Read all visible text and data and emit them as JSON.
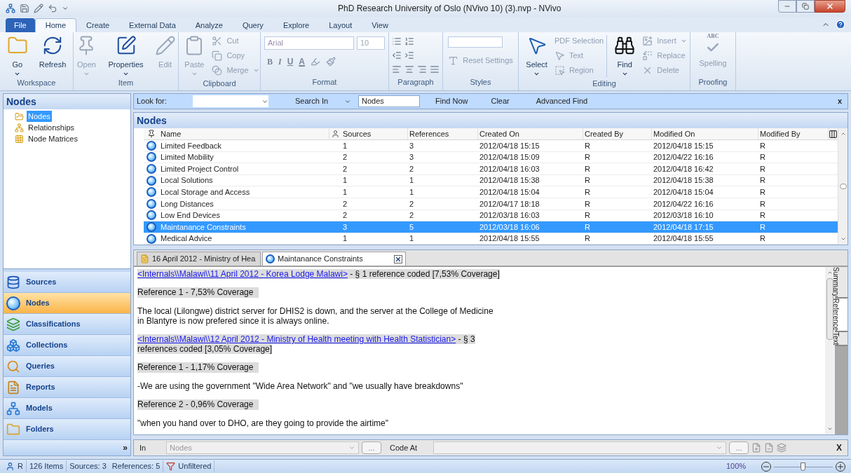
{
  "window": {
    "title": "PhD Research University of Oslo (NVivo 10) (3).nvp - NVivo"
  },
  "ribbon_tabs": [
    {
      "label": "File",
      "kind": "file",
      "selected": false
    },
    {
      "label": "Home",
      "kind": "tab",
      "selected": true
    },
    {
      "label": "Create",
      "kind": "tab",
      "selected": false
    },
    {
      "label": "External Data",
      "kind": "tab",
      "selected": false
    },
    {
      "label": "Analyze",
      "kind": "tab",
      "selected": false
    },
    {
      "label": "Query",
      "kind": "tab",
      "selected": false
    },
    {
      "label": "Explore",
      "kind": "tab",
      "selected": false
    },
    {
      "label": "Layout",
      "kind": "tab",
      "selected": false
    },
    {
      "label": "View",
      "kind": "tab",
      "selected": false
    }
  ],
  "ribbon": {
    "workspace": {
      "label": "Workspace",
      "go": {
        "label": "Go",
        "disabled": false
      },
      "refresh": {
        "label": "Refresh",
        "disabled": false
      }
    },
    "item": {
      "label": "Item",
      "open": {
        "label": "Open",
        "disabled": true
      },
      "properties": {
        "label": "Properties",
        "disabled": false
      },
      "edit": {
        "label": "Edit",
        "disabled": true
      }
    },
    "clipboard": {
      "label": "Clipboard",
      "paste": {
        "label": "Paste",
        "disabled": true
      },
      "cut": {
        "label": "Cut",
        "disabled": true
      },
      "copy": {
        "label": "Copy",
        "disabled": true
      },
      "merge": {
        "label": "Merge",
        "disabled": true
      }
    },
    "format": {
      "label": "Format",
      "font": {
        "value": "Arial",
        "disabled": true
      },
      "size": {
        "value": "10",
        "disabled": true
      },
      "bold": "B",
      "italic": "I",
      "underline": "U",
      "font_color": "A"
    },
    "paragraph": {
      "label": "Paragraph"
    },
    "styles": {
      "label": "Styles",
      "reset": {
        "label": "Reset Settings",
        "disabled": true
      }
    },
    "editing": {
      "label": "Editing",
      "select": {
        "label": "Select",
        "disabled": false
      },
      "pdf_selection": {
        "label": "PDF Selection",
        "disabled": true
      },
      "text": {
        "label": "Text",
        "disabled": true
      },
      "region": {
        "label": "Region",
        "disabled": true
      },
      "find": {
        "label": "Find",
        "disabled": false
      },
      "insert": {
        "label": "Insert",
        "disabled": true
      },
      "replace": {
        "label": "Replace",
        "disabled": true
      },
      "delete": {
        "label": "Delete",
        "disabled": true
      }
    },
    "proofing": {
      "label": "Proofing",
      "spelling": {
        "label": "Spelling",
        "badge": "ABC",
        "disabled": true
      }
    }
  },
  "navigation": {
    "title": "Nodes",
    "tree": [
      {
        "label": "Nodes",
        "selected": true
      },
      {
        "label": "Relationships",
        "selected": false
      },
      {
        "label": "Node Matrices",
        "selected": false
      }
    ],
    "buttons": [
      {
        "label": "Sources",
        "selected": false
      },
      {
        "label": "Nodes",
        "selected": true
      },
      {
        "label": "Classifications",
        "selected": false
      },
      {
        "label": "Collections",
        "selected": false
      },
      {
        "label": "Queries",
        "selected": false
      },
      {
        "label": "Reports",
        "selected": false
      },
      {
        "label": "Models",
        "selected": false
      },
      {
        "label": "Folders",
        "selected": false
      }
    ],
    "more": "»"
  },
  "find_bar": {
    "look_for_label": "Look for:",
    "search_in_label": "Search In",
    "search_in_value": "Nodes",
    "find_now": "Find Now",
    "clear": "Clear",
    "advanced_find": "Advanced Find",
    "close": "x"
  },
  "list": {
    "title": "Nodes",
    "columns": [
      "Name",
      "Sources",
      "References",
      "Created On",
      "Created By",
      "Modified On",
      "Modified By"
    ],
    "rows": [
      {
        "cells": [
          "Limited Feedback",
          "1",
          "3",
          "2012/04/18 15:15",
          "R",
          "2012/04/18 15:15",
          "R"
        ],
        "selected": false
      },
      {
        "cells": [
          "Limited Mobility",
          "2",
          "3",
          "2012/04/18 15:09",
          "R",
          "2012/04/22 16:16",
          "R"
        ],
        "selected": false
      },
      {
        "cells": [
          "Limited Project Control",
          "2",
          "2",
          "2012/04/18 16:03",
          "R",
          "2012/04/18 16:42",
          "R"
        ],
        "selected": false
      },
      {
        "cells": [
          "Local Solutions",
          "1",
          "1",
          "2012/04/18 15:38",
          "R",
          "2012/04/18 15:38",
          "R"
        ],
        "selected": false
      },
      {
        "cells": [
          "Local Storage and Access",
          "1",
          "1",
          "2012/04/18 15:04",
          "R",
          "2012/04/18 15:04",
          "R"
        ],
        "selected": false
      },
      {
        "cells": [
          "Long Distances",
          "2",
          "2",
          "2012/04/17 18:18",
          "R",
          "2012/04/22 16:16",
          "R"
        ],
        "selected": false
      },
      {
        "cells": [
          "Low End Devices",
          "2",
          "2",
          "2012/03/18 16:03",
          "R",
          "2012/03/18 16:10",
          "R"
        ],
        "selected": false
      },
      {
        "cells": [
          "Maintanance Constraints",
          "3",
          "5",
          "2012/03/18 16:06",
          "R",
          "2012/04/18 17:15",
          "R"
        ],
        "selected": true
      },
      {
        "cells": [
          "Medical Advice",
          "1",
          "1",
          "2012/04/18 15:55",
          "R",
          "2012/04/18 15:55",
          "R"
        ],
        "selected": false
      }
    ]
  },
  "document": {
    "tabs": [
      {
        "label": "16 April 2012 - Ministry of Hea",
        "kind": "source",
        "selected": false
      },
      {
        "label": "Maintanance Constraints",
        "kind": "node",
        "selected": true
      }
    ],
    "paragraphs": [
      {
        "kind": "source",
        "link": "<Internals\\\\Malawi\\\\11 April 2012 - Korea Lodge Malawi>",
        "text": " - § 1 reference coded  [7,53% Coverage]"
      },
      {
        "kind": "reference",
        "text": "Reference 1 - 7,53% Coverage"
      },
      {
        "kind": "quote",
        "text": "The local (Lilongwe) district server for DHIS2 is down, and the server at the College of Medicine in Blantyre is now prefered since it is always online."
      },
      {
        "kind": "source",
        "link": "<Internals\\\\Malawi\\\\12 April 2012 - Ministry of Health meeting with Health Statistician>",
        "text": " - § 3 references coded  [3,05% Coverage]"
      },
      {
        "kind": "reference",
        "text": "Reference 1 - 1,17% Coverage"
      },
      {
        "kind": "quote",
        "text": "-We are using the government \"Wide Area Network\" and \"we usually have breakdowns\""
      },
      {
        "kind": "reference",
        "text": "Reference 2 - 0,96% Coverage"
      },
      {
        "kind": "quote",
        "text": "\"when you hand over to DHO, are they going to provide the airtime\""
      }
    ],
    "side_tabs": [
      {
        "label": "Summary",
        "selected": false
      },
      {
        "label": "Reference",
        "selected": true
      },
      {
        "label": "Text",
        "selected": false
      }
    ]
  },
  "code_bar": {
    "in_label": "In",
    "in_value": "Nodes",
    "in_browse": "...",
    "code_at_label": "Code At",
    "code_at_browse": "...",
    "close": "X"
  },
  "status_bar": {
    "user": "R",
    "items": "126 Items",
    "sources": "Sources: 3",
    "references": "References: 5",
    "filter": "Unfiltered",
    "zoom": "100%",
    "zoom_slider": {
      "level": 0.5
    }
  }
}
